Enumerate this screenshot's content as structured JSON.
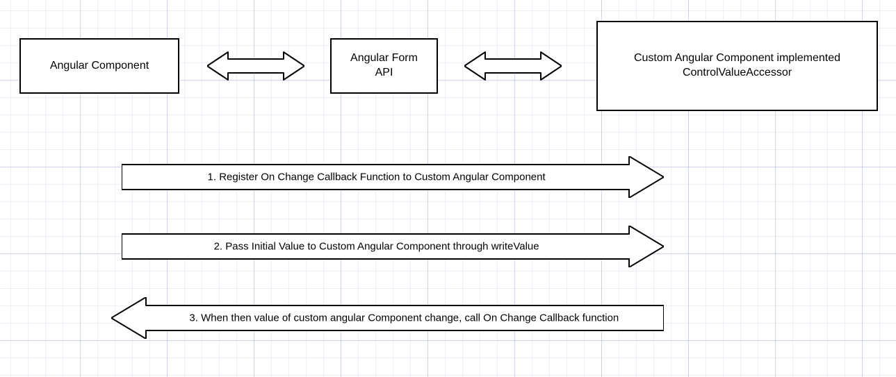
{
  "nodes": {
    "angular_component": "Angular Component",
    "angular_form_api": "Angular Form\nAPI",
    "custom_component": "Custom Angular Component implemented\nControlValueAccessor"
  },
  "steps": {
    "step1": "1. Register On Change Callback Function to Custom Angular Component",
    "step2": "2. Pass Initial Value to Custom Angular Component through writeValue",
    "step3": "3. When then value of custom angular Component change, call On Change Callback function"
  }
}
